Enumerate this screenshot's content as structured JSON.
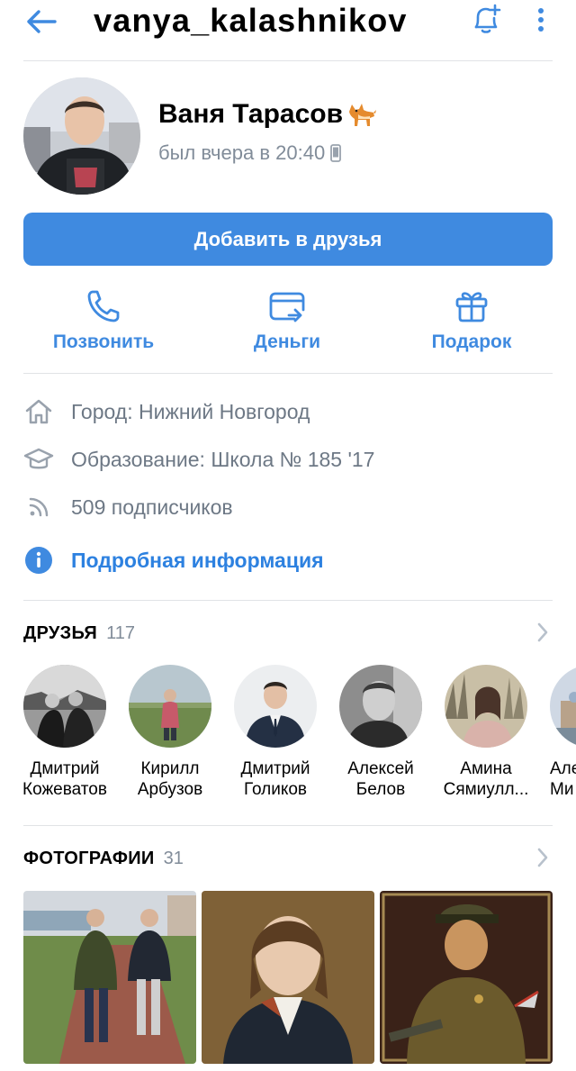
{
  "header": {
    "username": "vanya_kalashnikov"
  },
  "profile": {
    "name": "Ваня Тарасов",
    "status": "был вчера в 20:40"
  },
  "actions": {
    "add_friend": "Добавить в друзья",
    "call": "Позвонить",
    "money": "Деньги",
    "gift": "Подарок"
  },
  "info": {
    "city": "Город: Нижний Новгород",
    "education": "Образование: Школа № 185 '17",
    "followers": "509 подписчиков",
    "details": "Подробная информация"
  },
  "friends": {
    "title": "ДРУЗЬЯ",
    "count": "117",
    "items": [
      {
        "first": "Дмитрий",
        "last": "Кожеватов"
      },
      {
        "first": "Кирилл",
        "last": "Арбузов"
      },
      {
        "first": "Дмитрий",
        "last": "Голиков"
      },
      {
        "first": "Алексей",
        "last": "Белов"
      },
      {
        "first": "Амина",
        "last": "Сямиулл..."
      },
      {
        "first": "Але",
        "last": "Ми"
      }
    ]
  },
  "photos": {
    "title": "ФОТОГРАФИИ",
    "count": "31"
  },
  "colors": {
    "accent": "#3f8ae0",
    "link": "#2d81e0",
    "secondary_text": "#818c99",
    "icon_gray": "#99a2ad",
    "divider": "#e1e3e6"
  },
  "icons": {
    "back": "arrow-left-icon",
    "notify": "bell-plus-icon",
    "more": "more-vertical-icon",
    "call": "phone-icon",
    "money": "card-transfer-icon",
    "gift": "gift-icon",
    "city": "home-icon",
    "education": "graduation-cap-icon",
    "followers": "rss-icon",
    "details": "info-circle-icon"
  }
}
